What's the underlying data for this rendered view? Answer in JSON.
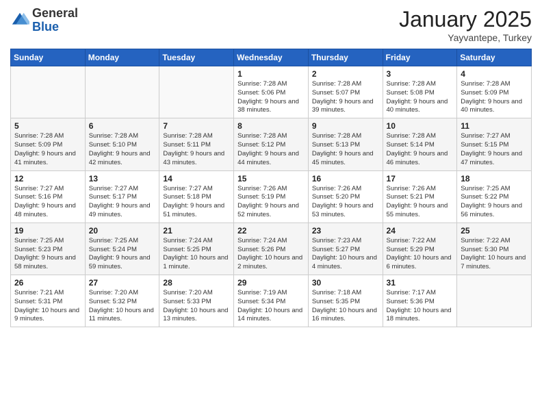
{
  "header": {
    "logo_general": "General",
    "logo_blue": "Blue",
    "month_title": "January 2025",
    "location": "Yayvantepe, Turkey"
  },
  "days_of_week": [
    "Sunday",
    "Monday",
    "Tuesday",
    "Wednesday",
    "Thursday",
    "Friday",
    "Saturday"
  ],
  "weeks": [
    [
      {
        "day": "",
        "info": ""
      },
      {
        "day": "",
        "info": ""
      },
      {
        "day": "",
        "info": ""
      },
      {
        "day": "1",
        "info": "Sunrise: 7:28 AM\nSunset: 5:06 PM\nDaylight: 9 hours and 38 minutes."
      },
      {
        "day": "2",
        "info": "Sunrise: 7:28 AM\nSunset: 5:07 PM\nDaylight: 9 hours and 39 minutes."
      },
      {
        "day": "3",
        "info": "Sunrise: 7:28 AM\nSunset: 5:08 PM\nDaylight: 9 hours and 40 minutes."
      },
      {
        "day": "4",
        "info": "Sunrise: 7:28 AM\nSunset: 5:09 PM\nDaylight: 9 hours and 40 minutes."
      }
    ],
    [
      {
        "day": "5",
        "info": "Sunrise: 7:28 AM\nSunset: 5:09 PM\nDaylight: 9 hours and 41 minutes."
      },
      {
        "day": "6",
        "info": "Sunrise: 7:28 AM\nSunset: 5:10 PM\nDaylight: 9 hours and 42 minutes."
      },
      {
        "day": "7",
        "info": "Sunrise: 7:28 AM\nSunset: 5:11 PM\nDaylight: 9 hours and 43 minutes."
      },
      {
        "day": "8",
        "info": "Sunrise: 7:28 AM\nSunset: 5:12 PM\nDaylight: 9 hours and 44 minutes."
      },
      {
        "day": "9",
        "info": "Sunrise: 7:28 AM\nSunset: 5:13 PM\nDaylight: 9 hours and 45 minutes."
      },
      {
        "day": "10",
        "info": "Sunrise: 7:28 AM\nSunset: 5:14 PM\nDaylight: 9 hours and 46 minutes."
      },
      {
        "day": "11",
        "info": "Sunrise: 7:27 AM\nSunset: 5:15 PM\nDaylight: 9 hours and 47 minutes."
      }
    ],
    [
      {
        "day": "12",
        "info": "Sunrise: 7:27 AM\nSunset: 5:16 PM\nDaylight: 9 hours and 48 minutes."
      },
      {
        "day": "13",
        "info": "Sunrise: 7:27 AM\nSunset: 5:17 PM\nDaylight: 9 hours and 49 minutes."
      },
      {
        "day": "14",
        "info": "Sunrise: 7:27 AM\nSunset: 5:18 PM\nDaylight: 9 hours and 51 minutes."
      },
      {
        "day": "15",
        "info": "Sunrise: 7:26 AM\nSunset: 5:19 PM\nDaylight: 9 hours and 52 minutes."
      },
      {
        "day": "16",
        "info": "Sunrise: 7:26 AM\nSunset: 5:20 PM\nDaylight: 9 hours and 53 minutes."
      },
      {
        "day": "17",
        "info": "Sunrise: 7:26 AM\nSunset: 5:21 PM\nDaylight: 9 hours and 55 minutes."
      },
      {
        "day": "18",
        "info": "Sunrise: 7:25 AM\nSunset: 5:22 PM\nDaylight: 9 hours and 56 minutes."
      }
    ],
    [
      {
        "day": "19",
        "info": "Sunrise: 7:25 AM\nSunset: 5:23 PM\nDaylight: 9 hours and 58 minutes."
      },
      {
        "day": "20",
        "info": "Sunrise: 7:25 AM\nSunset: 5:24 PM\nDaylight: 9 hours and 59 minutes."
      },
      {
        "day": "21",
        "info": "Sunrise: 7:24 AM\nSunset: 5:25 PM\nDaylight: 10 hours and 1 minute."
      },
      {
        "day": "22",
        "info": "Sunrise: 7:24 AM\nSunset: 5:26 PM\nDaylight: 10 hours and 2 minutes."
      },
      {
        "day": "23",
        "info": "Sunrise: 7:23 AM\nSunset: 5:27 PM\nDaylight: 10 hours and 4 minutes."
      },
      {
        "day": "24",
        "info": "Sunrise: 7:22 AM\nSunset: 5:29 PM\nDaylight: 10 hours and 6 minutes."
      },
      {
        "day": "25",
        "info": "Sunrise: 7:22 AM\nSunset: 5:30 PM\nDaylight: 10 hours and 7 minutes."
      }
    ],
    [
      {
        "day": "26",
        "info": "Sunrise: 7:21 AM\nSunset: 5:31 PM\nDaylight: 10 hours and 9 minutes."
      },
      {
        "day": "27",
        "info": "Sunrise: 7:20 AM\nSunset: 5:32 PM\nDaylight: 10 hours and 11 minutes."
      },
      {
        "day": "28",
        "info": "Sunrise: 7:20 AM\nSunset: 5:33 PM\nDaylight: 10 hours and 13 minutes."
      },
      {
        "day": "29",
        "info": "Sunrise: 7:19 AM\nSunset: 5:34 PM\nDaylight: 10 hours and 14 minutes."
      },
      {
        "day": "30",
        "info": "Sunrise: 7:18 AM\nSunset: 5:35 PM\nDaylight: 10 hours and 16 minutes."
      },
      {
        "day": "31",
        "info": "Sunrise: 7:17 AM\nSunset: 5:36 PM\nDaylight: 10 hours and 18 minutes."
      },
      {
        "day": "",
        "info": ""
      }
    ]
  ]
}
